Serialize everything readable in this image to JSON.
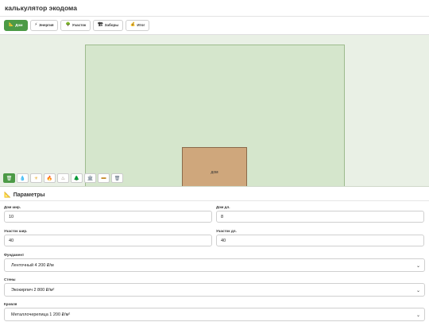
{
  "app": {
    "title": "калькулятор экодома"
  },
  "tabs": [
    {
      "icon": "ruler-icon",
      "glyph": "📐",
      "label": "Дом"
    },
    {
      "icon": "bolt-icon",
      "glyph": "⚡",
      "label": "Энергия"
    },
    {
      "icon": "tree-icon",
      "glyph": "🌳",
      "label": "Участок"
    },
    {
      "icon": "fence-icon",
      "glyph": "🏗",
      "label": "Заборы"
    },
    {
      "icon": "money-icon",
      "glyph": "💰",
      "label": "Итог"
    }
  ],
  "active_tab": "Дом",
  "canvas": {
    "house_label": "дом",
    "tools": [
      {
        "name": "trash-tool-icon",
        "glyph": "🗑"
      },
      {
        "name": "water-tool-icon",
        "glyph": "💧"
      },
      {
        "name": "sun-tool-icon",
        "glyph": "☀"
      },
      {
        "name": "fire-tool-icon",
        "glyph": "🔥"
      },
      {
        "name": "sauna-tool-icon",
        "glyph": "♨"
      },
      {
        "name": "tree-tool-icon",
        "glyph": "🌲"
      },
      {
        "name": "building-tool-icon",
        "glyph": "🏛"
      },
      {
        "name": "fence-tool-icon",
        "glyph": "▬"
      },
      {
        "name": "box-tool-icon",
        "glyph": "🗑"
      }
    ]
  },
  "params": {
    "title": "Параметры",
    "house_width_label": "Дом шир.",
    "house_width_value": "10",
    "house_length_label": "Дом дл.",
    "house_length_value": "8",
    "plot_width_label": "Участок шир.",
    "plot_width_value": "40",
    "plot_length_label": "Участок дл.",
    "plot_length_value": "40",
    "foundation_label": "Фундамент",
    "foundation_value": "Ленточный 4 200 ₽/м",
    "walls_label": "Стены",
    "walls_value": "Экокирпич 2 800 ₽/м²",
    "roof_label": "Кровля",
    "roof_value": "Металлочерепица 1 200 ₽/м²"
  },
  "colors": {
    "accent": "#4c9a46",
    "plot": "#d5e6cc",
    "house": "#cfa77c"
  }
}
